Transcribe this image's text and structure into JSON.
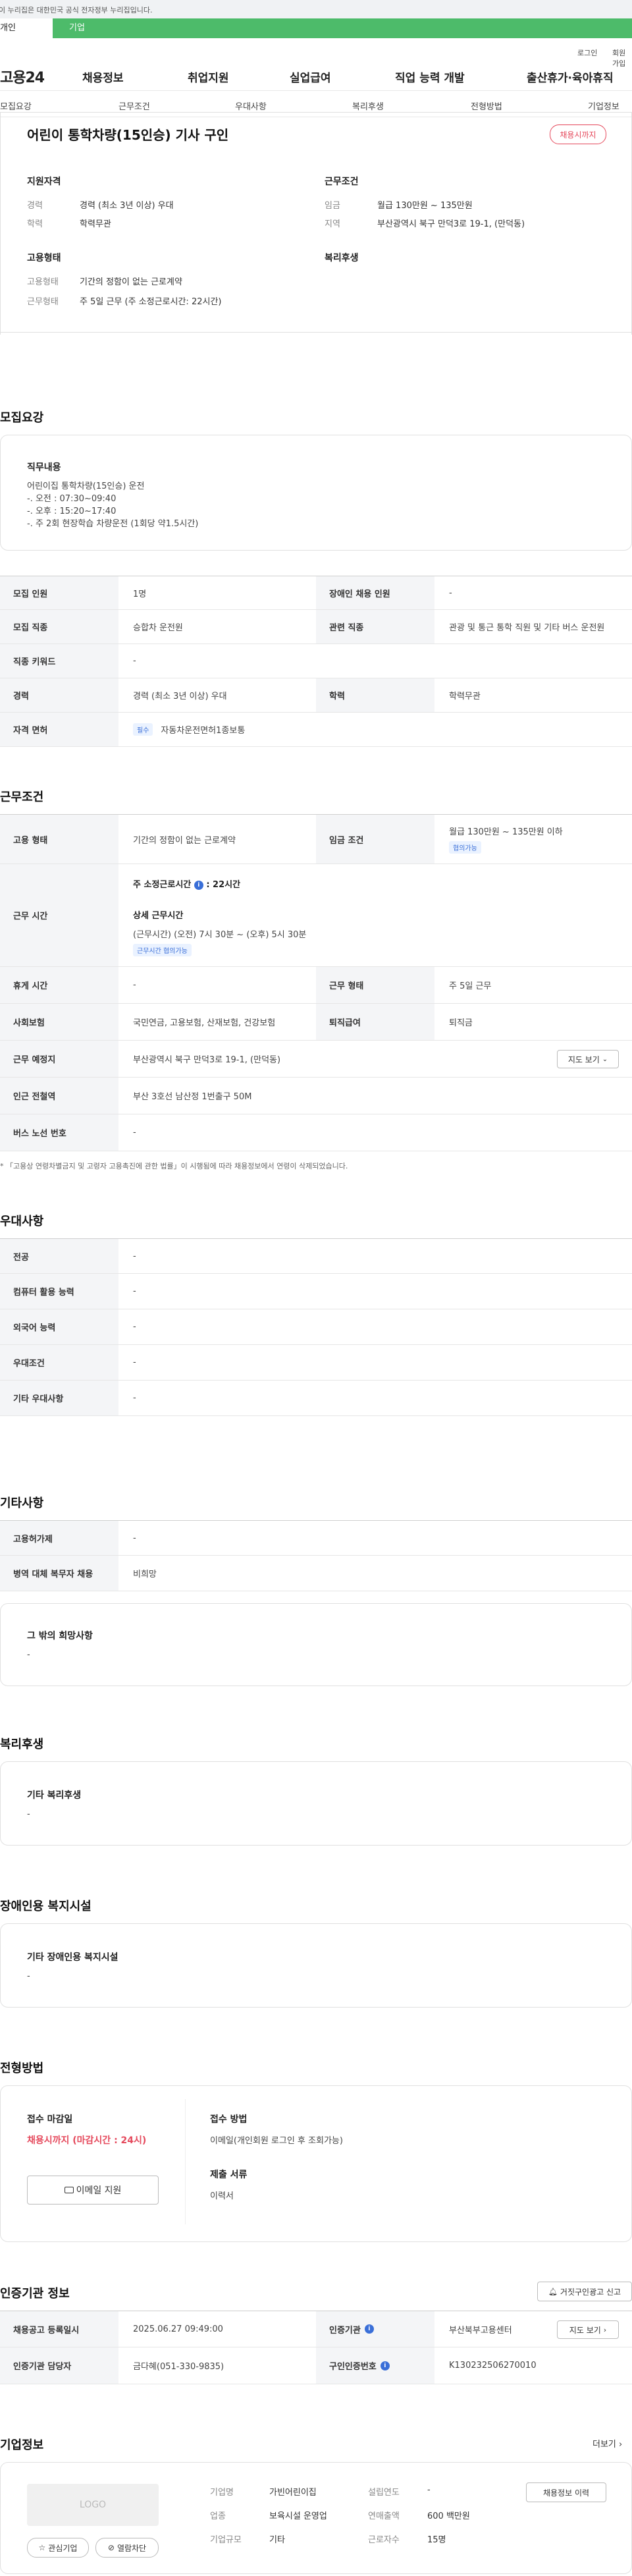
{
  "gov_notice": "이 누리집은 대한민국 공식 전자정부 누리집입니다.",
  "user_tabs": {
    "personal": "개인",
    "company": "기업"
  },
  "top_links": {
    "login": "로그인",
    "join": "회원가입"
  },
  "gnb": {
    "logo": "고용24",
    "items": [
      "채용정보",
      "취업지원",
      "실업급여",
      "직업 능력 개발",
      "출산휴가·육아휴직"
    ]
  },
  "snb": [
    "모집요강",
    "근무조건",
    "우대사항",
    "복리후생",
    "전형방법",
    "기업정보"
  ],
  "job": {
    "title": "어린이 통학차량(15인승) 기사 구인",
    "status_badge": "채용시까지",
    "summary": {
      "qual_title": "지원자격",
      "career_label": "경력",
      "career_value": "경력 (최소 3년 이상) 우대",
      "edu_label": "학력",
      "edu_value": "학력무관",
      "emp_title": "고용형태",
      "emptype_label": "고용형태",
      "emptype_value": "기간의 정함이 없는 근로계약",
      "worktype_label": "근무형태",
      "worktype_value": "주 5일 근무 (주 소정근로시간: 22시간)",
      "cond_title": "근무조건",
      "wage_label": "임금",
      "wage_value": "월급 130만원 ~ 135만원",
      "area_label": "지역",
      "area_value": "부산광역시 북구 만덕3로 19-1, (만덕동)",
      "welfare_title": "복리후생"
    }
  },
  "recruit": {
    "title": "모집요강",
    "duty_title": "직무내용",
    "duty_text": "어린이집 통학차량(15인승) 운전\n-. 오전 : 07:30~09:40\n-. 오후 : 15:20~17:40\n-. 주 2회 현장학습 차량운전 (1회당 약1.5시간)",
    "rows": {
      "headcount_label": "모집 인원",
      "headcount_value": "1명",
      "disabled_label": "장애인 채용 인원",
      "disabled_value": "-",
      "job_label": "모집 직종",
      "job_value": "승합차 운전원",
      "related_label": "관련 직종",
      "related_value": "관광 및 통근 통학 직원 및 기타 버스 운전원",
      "keyword_label": "직종 키워드",
      "keyword_value": "-",
      "career_label": "경력",
      "career_value": "경력 (최소 3년 이상) 우대",
      "edu_label": "학력",
      "edu_value": "학력무관",
      "license_label": "자격 면허",
      "license_tag": "필수",
      "license_value": "자동차운전면허1종보통"
    }
  },
  "conditions": {
    "title": "근무조건",
    "emptype_label": "고용 형태",
    "emptype_value": "기간의 정함이 없는 근로계약",
    "wage_label": "임금 조건",
    "wage_value": "월급 130만원 ~ 135만원 이하",
    "wage_tag": "협의가능",
    "hours_label": "근무 시간",
    "hours_weekly": "주 소정근로시간",
    "hours_weekly_value": ": 22시간",
    "hours_detail_title": "상세 근무시간",
    "hours_detail": "(근무시간) (오전) 7시 30분 ~ (오후) 5시 30분",
    "hours_tag": "근무시간 협의가능",
    "break_label": "휴게 시간",
    "break_value": "-",
    "worktype_label": "근무 형태",
    "worktype_value": "주 5일 근무",
    "insurance_label": "사회보험",
    "insurance_value": "국민연금, 고용보험, 산재보험, 건강보험",
    "severance_label": "퇴직급여",
    "severance_value": "퇴직금",
    "place_label": "근무 예정지",
    "place_value": "부산광역시 북구 만덕3로 19-1, (만덕동)",
    "map_button": "지도 보기",
    "subway_label": "인근 전철역",
    "subway_value": "부산 3호선 남산정 1번출구 50M",
    "bus_label": "버스 노선 번호",
    "bus_value": "-",
    "notice": "「고용상 연령차별금지 및 고령자 고용촉진에 관한 법률」이 시행됨에 따라 채용정보에서 연령이 삭제되었습니다."
  },
  "preference": {
    "title": "우대사항",
    "rows": [
      {
        "label": "전공",
        "value": "-"
      },
      {
        "label": "컴퓨터 활용 능력",
        "value": "-"
      },
      {
        "label": "외국어 능력",
        "value": "-"
      },
      {
        "label": "우대조건",
        "value": "-"
      },
      {
        "label": "기타 우대사항",
        "value": "-"
      }
    ]
  },
  "etc": {
    "title": "기타사항",
    "rows": [
      {
        "label": "고용허가제",
        "value": "-"
      },
      {
        "label": "병역 대체 복무자 채용",
        "value": "비희망"
      }
    ],
    "other_title": "그 밖의 희망사항",
    "other_value": "-"
  },
  "welfare": {
    "title": "복리후생",
    "box_title": "기타 복리후생",
    "box_value": "-"
  },
  "disabled": {
    "title": "장애인용 복지시설",
    "box_title": "기타 장애인용 복지시설",
    "box_value": "-"
  },
  "screening": {
    "title": "전형방법",
    "deadline_label": "접수 마감일",
    "deadline_value": "채용시까지 (마감시간 : 24시)",
    "email_button": "이메일 지원",
    "method_label": "접수 방법",
    "method_value": "이메일(개인회원 로그인 후 조회가능)",
    "docs_label": "제출 서류",
    "docs_value": "이력서"
  },
  "agency": {
    "title": "인증기관 정보",
    "report_button": "거짓구인광고 신고",
    "reg_date_label": "채용공고 등록일시",
    "reg_date_value": "2025.06.27 09:49:00",
    "agency_label": "인증기관",
    "agency_value": "부산북부고용센터",
    "map_button": "지도 보기",
    "manager_label": "인증기관 담당자",
    "manager_value": "금다혜(051-330-9835)",
    "cert_label": "구인인증번호",
    "cert_value": "K130232506270010"
  },
  "company": {
    "title": "기업정보",
    "more": "더보기",
    "logo_text": "LOGO",
    "fav_button": "관심기업",
    "block_button": "열람차단",
    "name_label": "기업명",
    "name_value": "가빈어린이집",
    "industry_label": "업종",
    "industry_value": "보육시설 운영업",
    "size_label": "기업규모",
    "size_value": "기타",
    "founded_label": "설립연도",
    "founded_value": "-",
    "sales_label": "연매출액",
    "sales_value": "600 백만원",
    "employees_label": "근로자수",
    "employees_value": "15명",
    "history_button": "채용정보 이력"
  }
}
